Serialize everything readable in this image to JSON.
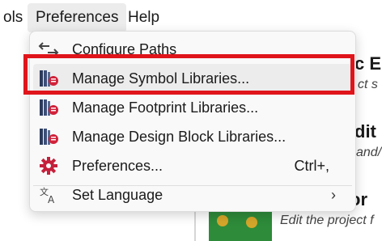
{
  "menubar": {
    "tools_label": "ols",
    "preferences_label": "Preferences",
    "help_label": "Help"
  },
  "background": {
    "frag1": "c E",
    "frag2": "ct s",
    "frag3": "dit",
    "frag4": "and/",
    "frag5": "or",
    "frag6": "Edit the project f"
  },
  "menu": {
    "items": [
      {
        "label": "Configure Paths",
        "icon": "folder-paths-icon"
      },
      {
        "label": "Manage Symbol Libraries...",
        "icon": "symbol-library-icon"
      },
      {
        "label": "Manage Footprint Libraries...",
        "icon": "footprint-library-icon"
      },
      {
        "label": "Manage Design Block Libraries...",
        "icon": "design-block-library-icon"
      },
      {
        "label": "Preferences...",
        "icon": "gear-icon",
        "shortcut": "Ctrl+,"
      },
      {
        "label": "Set Language",
        "icon": "translate-icon",
        "submenu": "›"
      }
    ]
  },
  "colors": {
    "highlight": "#e0141b",
    "gear": "#c4213c",
    "library_red": "#d0223a"
  }
}
